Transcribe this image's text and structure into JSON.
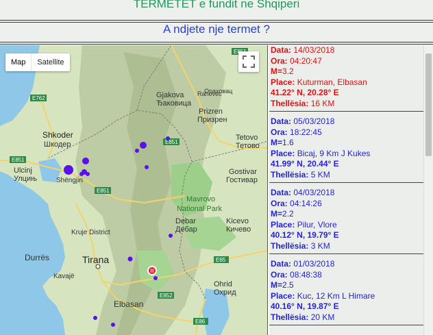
{
  "header": {
    "title": "TERMETET e fundit ne Shqiperi",
    "subtitle": "A ndjete nje termet ?"
  },
  "map": {
    "controls": {
      "map_label": "Map",
      "satellite_label": "Satellite"
    },
    "places": [
      {
        "name": "Gjakova",
        "alt": "Ђаковица"
      },
      {
        "name": "Prizren",
        "alt": "Призрен"
      },
      {
        "name": "Rahovec",
        "alt": "Ораховац"
      },
      {
        "name": "Shkoder",
        "alt": "Шкодер"
      },
      {
        "name": "Ulcinj",
        "alt": "Улцињ"
      },
      {
        "name": "Shëngjin",
        "alt": ""
      },
      {
        "name": "Tetovo",
        "alt": "Тетово"
      },
      {
        "name": "Gostivar",
        "alt": "Гостивар"
      },
      {
        "name": "Mavrovo",
        "alt": "National Park"
      },
      {
        "name": "Debar",
        "alt": "Дебар"
      },
      {
        "name": "Kicevo",
        "alt": "Кичево"
      },
      {
        "name": "Kruje District",
        "alt": ""
      },
      {
        "name": "Durrës",
        "alt": ""
      },
      {
        "name": "Tirana",
        "alt": ""
      },
      {
        "name": "Ohrid",
        "alt": "Охрид"
      },
      {
        "name": "Elbasan",
        "alt": ""
      },
      {
        "name": "Kavajë",
        "alt": ""
      }
    ],
    "roads": [
      "E851",
      "E762",
      "E851",
      "E851",
      "E851",
      "E65",
      "E852",
      "E86"
    ],
    "markers_color": "#5a10e8",
    "selected_marker_color": "#e01010"
  },
  "earthquakes": [
    {
      "date_label": "Data:",
      "date": "14/03/2018",
      "time_label": "Ora:",
      "time": "04:20:47",
      "mag_label": "M=",
      "mag": "3.2",
      "place_label": "Place:",
      "place": "Kuturman, Elbasan",
      "coords": "41.22° N, 20.28° E",
      "depth_label": "Thellësia:",
      "depth": "16 KM",
      "color": "red"
    },
    {
      "date_label": "Data:",
      "date": "05/03/2018",
      "time_label": "Ora:",
      "time": "18:22:45",
      "mag_label": "M=",
      "mag": "1.6",
      "place_label": "Place:",
      "place": "Bicaj, 9 Km J Kukes",
      "coords": "41.99° N, 20.44° E",
      "depth_label": "Thellësia:",
      "depth": "5 KM",
      "color": "blue"
    },
    {
      "date_label": "Data:",
      "date": "04/03/2018",
      "time_label": "Ora:",
      "time": "04:14:26",
      "mag_label": "M=",
      "mag": "2.2",
      "place_label": "Place:",
      "place": "Pilur, Vlore",
      "coords": "40.12° N, 19.79° E",
      "depth_label": "Thellësia:",
      "depth": "3 KM",
      "color": "blue"
    },
    {
      "date_label": "Data:",
      "date": "01/03/2018",
      "time_label": "Ora:",
      "time": "08:48:38",
      "mag_label": "M=",
      "mag": "2.5",
      "place_label": "Place:",
      "place": "Kuc, 12 Km L Himare",
      "coords": "40.16° N, 19.87° E",
      "depth_label": "Thellësia:",
      "depth": "20 KM",
      "color": "blue"
    }
  ]
}
